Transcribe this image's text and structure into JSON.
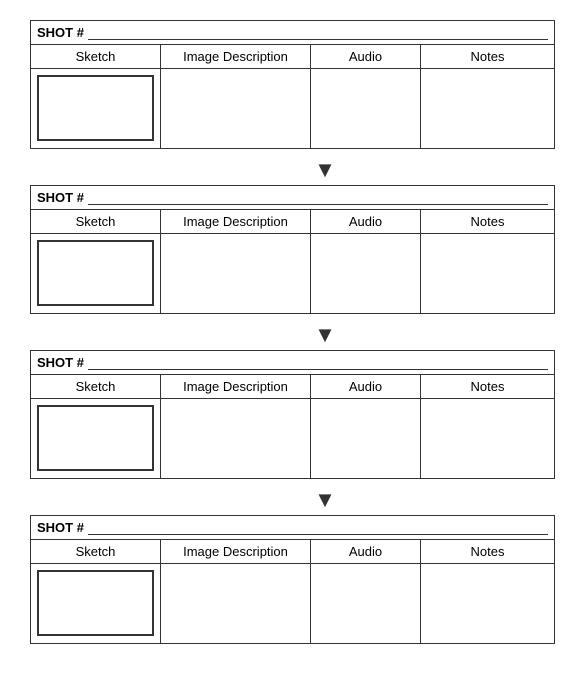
{
  "shots": [
    {
      "id": "shot1",
      "label": "SHOT #",
      "columns": {
        "sketch": "Sketch",
        "imageDesc": "Image Description",
        "audio": "Audio",
        "notes": "Notes"
      }
    },
    {
      "id": "shot2",
      "label": "SHOT #",
      "columns": {
        "sketch": "Sketch",
        "imageDesc": "Image Description",
        "audio": "Audio",
        "notes": "Notes"
      }
    },
    {
      "id": "shot3",
      "label": "SHOT #",
      "columns": {
        "sketch": "Sketch",
        "imageDesc": "Image Description",
        "audio": "Audio",
        "notes": "Notes"
      }
    },
    {
      "id": "shot4",
      "label": "SHOT #",
      "columns": {
        "sketch": "Sketch",
        "imageDesc": "Image Description",
        "audio": "Audio",
        "notes": "Notes"
      }
    }
  ],
  "arrow": "▼"
}
